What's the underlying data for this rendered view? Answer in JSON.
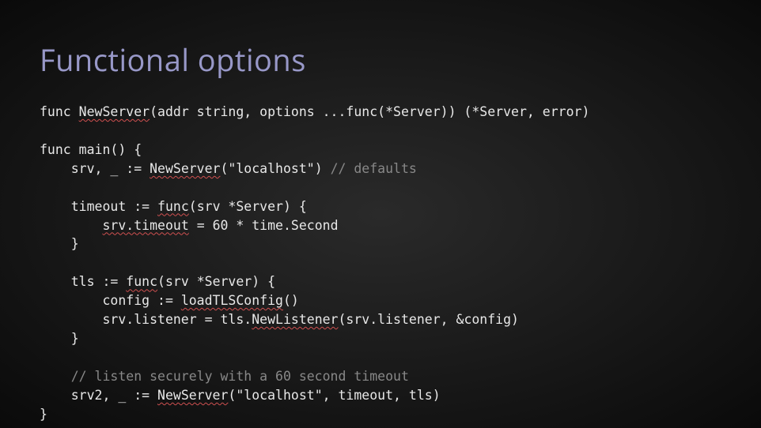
{
  "slide": {
    "title": "Functional options",
    "code": {
      "line1_pre": "func ",
      "line1_u1": "NewServer",
      "line1_post": "(addr string, options ...func(*Server)) (*Server, error)",
      "line2": "",
      "line3": "func main() {",
      "line4_pre": "    srv, _ := ",
      "line4_u1": "NewServer",
      "line4_mid": "(\"localhost\") ",
      "line4_comment": "// defaults",
      "line5": "",
      "line6_pre": "    timeout := ",
      "line6_u1": "func",
      "line6_post": "(srv *Server) {",
      "line7_pre": "        ",
      "line7_u1": "srv.timeout",
      "line7_post": " = 60 * time.Second",
      "line8": "    }",
      "line9": "",
      "line10_pre": "    tls := ",
      "line10_u1": "func",
      "line10_post": "(srv *Server) {",
      "line11_pre": "        config := ",
      "line11_u1": "loadTLSConfig",
      "line11_post": "()",
      "line12_pre": "        srv.listener = tls.",
      "line12_u1": "NewListener",
      "line12_post": "(srv.listener, &config)",
      "line13": "    }",
      "line14": "",
      "line15_comment": "    // listen securely with a 60 second timeout",
      "line16_pre": "    srv2, _ := ",
      "line16_u1": "NewServer",
      "line16_post": "(\"localhost\", timeout, tls)",
      "line17": "}"
    }
  }
}
